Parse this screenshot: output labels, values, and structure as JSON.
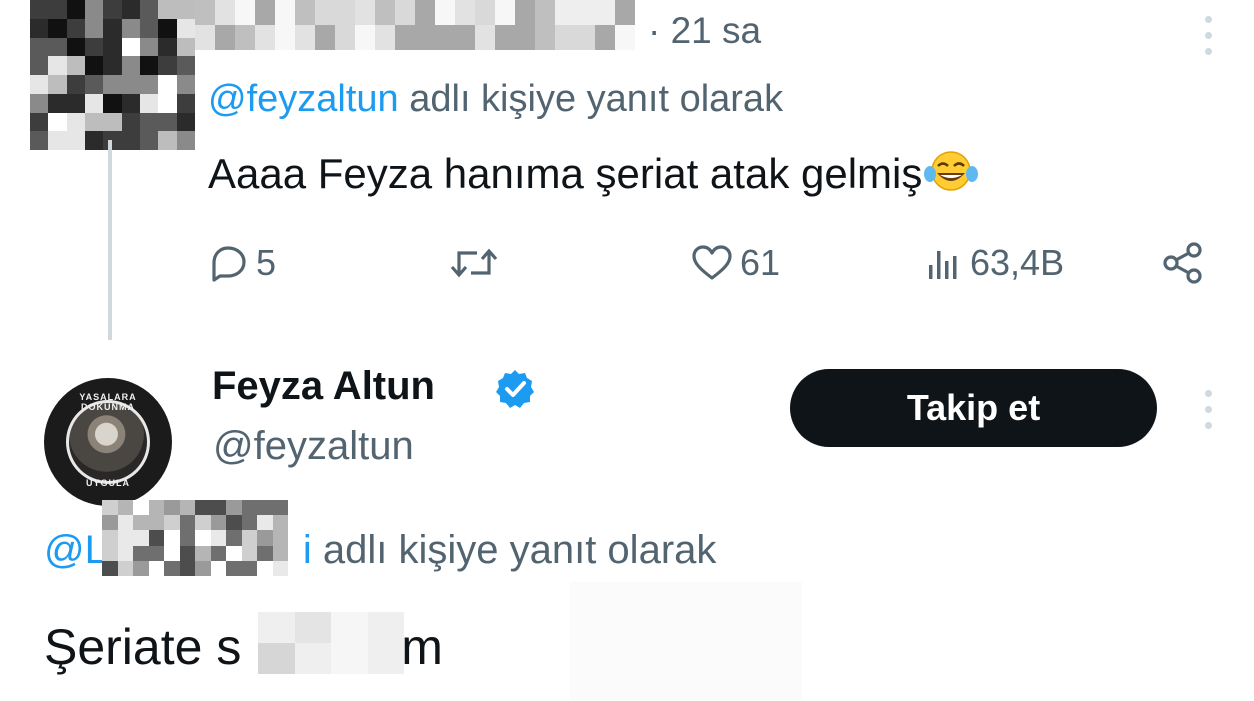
{
  "reply_tweet": {
    "timestamp": "· 21 sa",
    "replying_handle": "@feyzaltun",
    "replying_suffix": " adlı kişiye yanıt olarak",
    "text": "Aaaa Feyza hanıma şeriat atak gelmiş",
    "emoji_icon": "face-with-tears-of-joy-icon",
    "actions": {
      "reply_count": "5",
      "retweet_count": "",
      "like_count": "61",
      "views_count": "63,4B"
    }
  },
  "main_tweet": {
    "display_name": "Feyza Altun",
    "handle": "@feyzaltun",
    "verified_icon": "verified-badge-icon",
    "follow_label": "Takip et",
    "avatar_ring_top": "YASALARA DOKUNMA",
    "avatar_ring_bottom": "UYGULA",
    "replying_prefix": "@L",
    "replying_visible_end": "i",
    "replying_suffix": " adlı kişiye yanıt olarak",
    "text_start": "Şeriate s",
    "text_end": "ım"
  },
  "colors": {
    "text_primary": "#0f1419",
    "text_secondary": "#536471",
    "link": "#1d9bf0",
    "button_bg": "#0f1419",
    "divider": "#cfd9de"
  }
}
